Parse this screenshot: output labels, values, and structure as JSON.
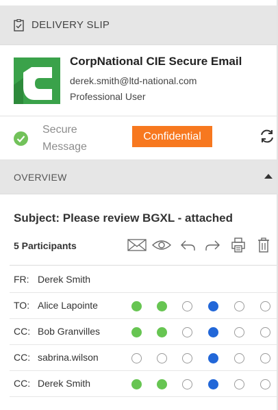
{
  "header": {
    "title": "DELIVERY SLIP",
    "icon": "checklist-icon"
  },
  "sender": {
    "logo_letter": "C",
    "logo_color": "#3aa24a",
    "name": "CorpNational CIE Secure Email",
    "email": "derek.smith@ltd-national.com",
    "role": "Professional User"
  },
  "security": {
    "status_line1": "Secure",
    "status_line2": "Message",
    "badge": "Confidential",
    "badge_color": "#f7781f",
    "status_color": "#72c25a"
  },
  "overview": {
    "label": "OVERVIEW"
  },
  "message": {
    "subject": "Subject: Please review BGXL - attached",
    "participants_label": "5 Participants",
    "actions": [
      "envelope-icon",
      "eye-icon",
      "reply-icon",
      "forward-icon",
      "print-icon",
      "trash-icon"
    ]
  },
  "recipients": [
    {
      "role": "FR:",
      "name": "Derek Smith",
      "status": []
    },
    {
      "role": "TO:",
      "name": "Alice Lapointe",
      "status": [
        "green",
        "green",
        "empty",
        "blue",
        "empty",
        "empty"
      ]
    },
    {
      "role": "CC:",
      "name": "Bob Granvilles",
      "status": [
        "green",
        "green",
        "empty",
        "blue",
        "empty",
        "empty"
      ]
    },
    {
      "role": "CC:",
      "name": "sabrina.wilson",
      "status": [
        "empty",
        "empty",
        "empty",
        "blue",
        "empty",
        "empty"
      ]
    },
    {
      "role": "CC:",
      "name": "Derek Smith",
      "status": [
        "green",
        "green",
        "empty",
        "blue",
        "empty",
        "empty"
      ]
    }
  ]
}
